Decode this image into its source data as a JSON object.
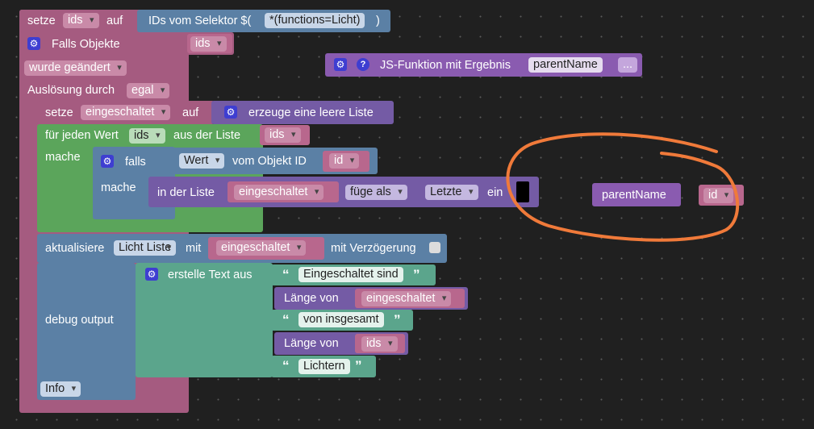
{
  "blocks": {
    "set_ids": {
      "set_label": "setze",
      "var": "ids",
      "to_label": "auf",
      "selector_label": "IDs vom Selektor $(",
      "selector_value": "*(functions=Licht)",
      "close_paren": ")"
    },
    "trigger": {
      "if_objects_label": "Falls Objekte",
      "var": "ids",
      "changed_value": "wurde geändert",
      "trigger_label": "Auslösung durch",
      "trigger_value": "egal"
    },
    "js_function": {
      "label": "JS-Funktion mit Ergebnis",
      "name": "parentName",
      "more": "..."
    },
    "set_enabled": {
      "set_label": "setze",
      "var": "eingeschaltet",
      "to_label": "auf",
      "create_list_label": "erzeuge eine leere Liste"
    },
    "foreach": {
      "label": "für jeden Wert",
      "var": "ids",
      "list_label": "aus der Liste",
      "list_var": "ids",
      "do_label": "mache"
    },
    "if_block": {
      "if_label": "falls",
      "value_field": "Wert",
      "from_object_label": "vom Objekt ID",
      "id_var": "id",
      "do_label": "mache"
    },
    "list_insert": {
      "in_list_label": "in der Liste",
      "list_var": "eingeschaltet",
      "mode": "füge als",
      "position": "Letzte",
      "suffix": "ein"
    },
    "loose_call": {
      "name": "parentName",
      "arg": "id"
    },
    "update": {
      "label": "aktualisiere",
      "target": "Licht Liste",
      "with_label": "mit",
      "var": "eingeschaltet",
      "delay_label": "mit Verzögerung"
    },
    "debug": {
      "label": "debug output",
      "create_text_label": "erstelle Text aus",
      "text1": "Eingeschaltet sind",
      "length_label": "Länge von",
      "length_var1": "eingeschaltet",
      "text2": "von insgesamt",
      "length_var2": "ids",
      "text3": "Lichtern",
      "level": "Info"
    }
  },
  "icons": {
    "gear": "⚙",
    "help": "?",
    "open_quote": "“",
    "close_quote": "”"
  },
  "colors": {
    "workspace": "#202020",
    "event_pink": "#a55b80",
    "variable_pink": "#b8678d",
    "loop_green": "#5ba55b",
    "logic_blue": "#5b80a5",
    "list_purple": "#745ba5",
    "text_teal": "#5ba58c",
    "function_violet": "#8a5bb0",
    "annotation_orange": "#f07a3a"
  }
}
